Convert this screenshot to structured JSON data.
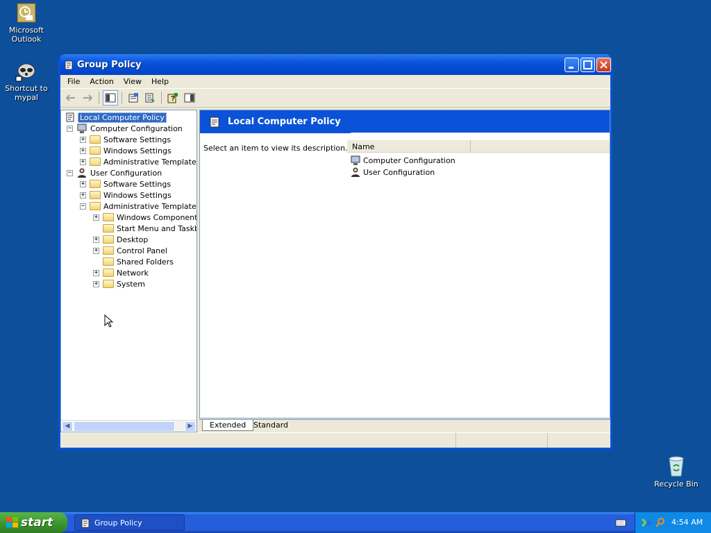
{
  "desktop": {
    "icons": [
      {
        "label": "Microsoft Outlook",
        "icon": "outlook-icon"
      },
      {
        "label": "Shortcut to mypal",
        "icon": "mypal-icon"
      },
      {
        "label": "Recycle Bin",
        "icon": "recycle-bin-icon"
      }
    ]
  },
  "window": {
    "title": "Group Policy",
    "menu": [
      "File",
      "Action",
      "View",
      "Help"
    ],
    "toolbar": [
      "back-arrow-icon",
      "forward-arrow-icon",
      "show-hide-tree-icon",
      "properties-icon",
      "export-list-icon",
      "help-icon",
      "show-hide-action-pane-icon"
    ],
    "tree": {
      "root": "Local Computer Policy",
      "nodes": [
        {
          "label": "Computer Configuration",
          "level": 1,
          "expander": "−"
        },
        {
          "label": "Software Settings",
          "level": 2,
          "expander": "+"
        },
        {
          "label": "Windows Settings",
          "level": 2,
          "expander": "+"
        },
        {
          "label": "Administrative Templates",
          "level": 2,
          "expander": "+"
        },
        {
          "label": "User Configuration",
          "level": 1,
          "expander": "−"
        },
        {
          "label": "Software Settings",
          "level": 2,
          "expander": "+"
        },
        {
          "label": "Windows Settings",
          "level": 2,
          "expander": "+"
        },
        {
          "label": "Administrative Templates",
          "level": 2,
          "expander": "−"
        },
        {
          "label": "Windows Components",
          "level": 3,
          "expander": "+"
        },
        {
          "label": "Start Menu and Taskbar",
          "level": 3,
          "expander": ""
        },
        {
          "label": "Desktop",
          "level": 3,
          "expander": "+"
        },
        {
          "label": "Control Panel",
          "level": 3,
          "expander": "+"
        },
        {
          "label": "Shared Folders",
          "level": 3,
          "expander": ""
        },
        {
          "label": "Network",
          "level": 3,
          "expander": "+"
        },
        {
          "label": "System",
          "level": 3,
          "expander": "+"
        }
      ]
    },
    "right_pane": {
      "heading": "Local Computer Policy",
      "description": "Select an item to view its description.",
      "column_header": "Name",
      "items": [
        "Computer Configuration",
        "User Configuration"
      ],
      "tabs": [
        "Extended",
        "Standard"
      ]
    }
  },
  "taskbar": {
    "start_label": "start",
    "items": [
      "Group Policy"
    ],
    "clock": "4:54 AM"
  }
}
